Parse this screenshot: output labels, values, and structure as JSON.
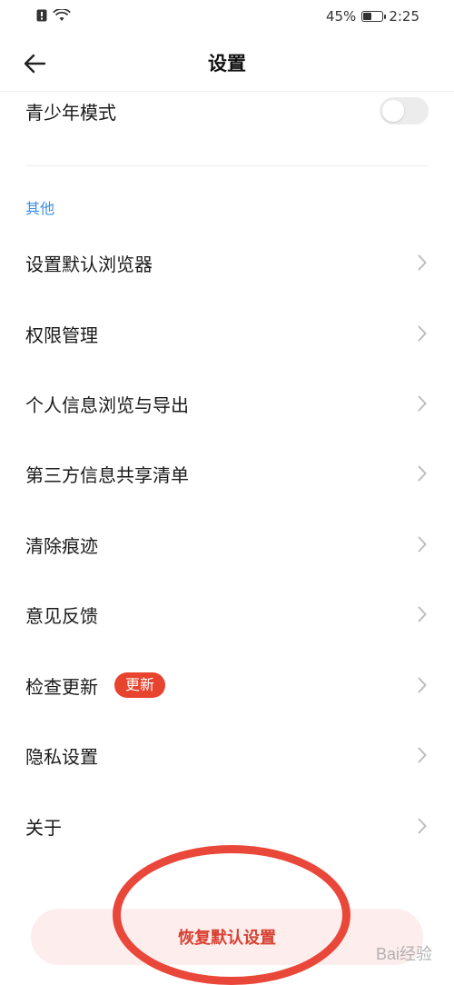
{
  "status_bar": {
    "battery_text": "45%",
    "battery_level": 0.45,
    "time": "2:25"
  },
  "header": {
    "title": "设置"
  },
  "youth_mode": {
    "label": "青少年模式",
    "enabled": false
  },
  "section_other": {
    "title": "其他"
  },
  "items": [
    {
      "label": "设置默认浏览器"
    },
    {
      "label": "权限管理"
    },
    {
      "label": "个人信息浏览与导出"
    },
    {
      "label": "第三方信息共享清单"
    },
    {
      "label": "清除痕迹"
    },
    {
      "label": "意见反馈"
    },
    {
      "label": "检查更新",
      "badge": "更新"
    },
    {
      "label": "隐私设置"
    },
    {
      "label": "关于"
    }
  ],
  "reset_button": {
    "label": "恢复默认设置"
  },
  "watermark": {
    "text": "Bai经验"
  },
  "colors": {
    "accent_blue": "#3a8ee6",
    "badge_red": "#e8432e",
    "reset_text": "#d94032"
  }
}
